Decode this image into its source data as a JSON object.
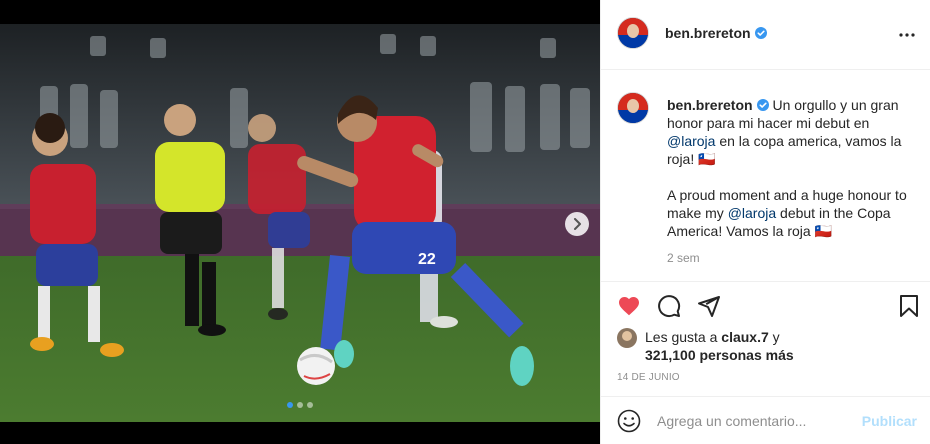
{
  "post": {
    "author": "ben.brereton",
    "caption_es": "Un orgullo y un gran honor para mi hacer mi debut en",
    "mention": "@laroja",
    "caption_es_2": " en la copa america, vamos la roja!",
    "caption_en_1": "A proud moment and a huge honour to make my ",
    "caption_en_2": " debut in the Copa America! Vamos la roja",
    "flag_emoji": "🇨🇱",
    "time_ago": "2 sem",
    "likes_prefix": "Les gusta a ",
    "likes_user": "claux.7",
    "likes_suffix": " y",
    "likes_count": "321,100 personas más",
    "date": "14 DE JUNIO"
  },
  "carousel": {
    "total": 3,
    "current": 1
  },
  "comment": {
    "placeholder": "Agrega un comentario...",
    "post_label": "Publicar"
  },
  "colors": {
    "like_red": "#ed4956",
    "verified_blue": "#3897f0",
    "mention_blue": "#00376b",
    "post_disabled": "#b2dffc"
  }
}
